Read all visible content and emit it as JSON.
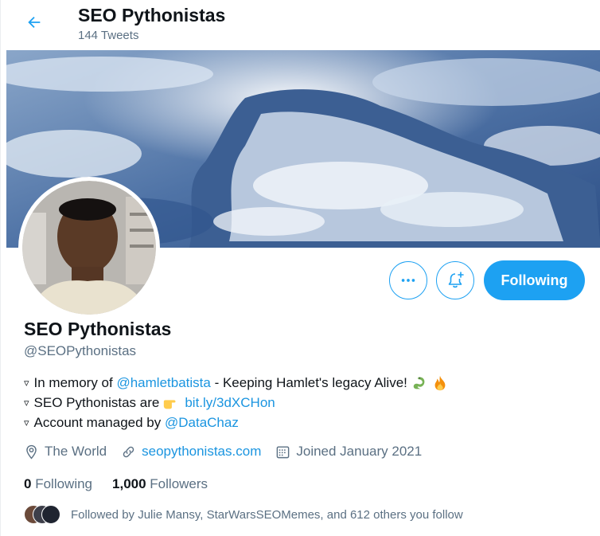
{
  "header": {
    "title": "SEO Pythonistas",
    "tweet_count": "144 Tweets"
  },
  "actions": {
    "follow_label": "Following"
  },
  "profile": {
    "name": "SEO Pythonistas",
    "handle": "@SEOPythonistas",
    "bio": {
      "line1_prefix": "In memory of",
      "line1_link": "@hamletbatista",
      "line1_suffix": "- Keeping Hamlet's legacy Alive!",
      "line2_prefix": "SEO Pythonistas are",
      "line2_link": "bit.ly/3dXCHon",
      "line3_prefix": "Account managed by",
      "line3_link": "@DataChaz"
    },
    "location": "The World",
    "website": "seopythonistas.com",
    "joined": "Joined January 2021",
    "following_count": "0",
    "following_label": "Following",
    "followers_count": "1,000",
    "followers_label": "Followers",
    "followed_by": "Followed by Julie Mansy, StarWarsSEOMemes, and 612 others you follow"
  },
  "colors": {
    "accent": "#1da1f2",
    "link": "#1b95e0",
    "muted": "#5b7083"
  }
}
